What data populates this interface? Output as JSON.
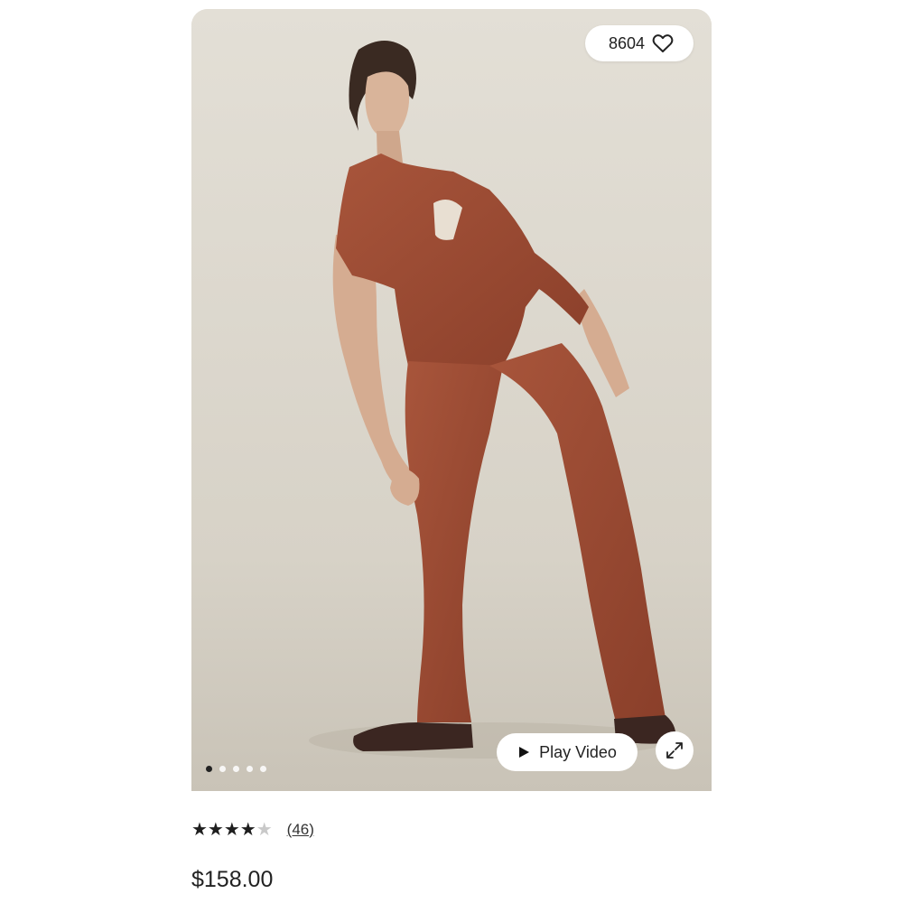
{
  "product": {
    "likes": "8604",
    "play_video_label": "Play Video",
    "rating_stars": "★★★★",
    "rating_partial_star": "★",
    "review_count": "(46)",
    "price": "$158.00"
  },
  "carousel": {
    "total_dots": 5,
    "active_index": 0
  },
  "icons": {
    "like": "heart-icon",
    "play": "play-icon",
    "expand": "expand-icon"
  },
  "colors": {
    "jumpsuit": "#9a4a33",
    "background": "#dcd7cd",
    "text": "#222222"
  }
}
